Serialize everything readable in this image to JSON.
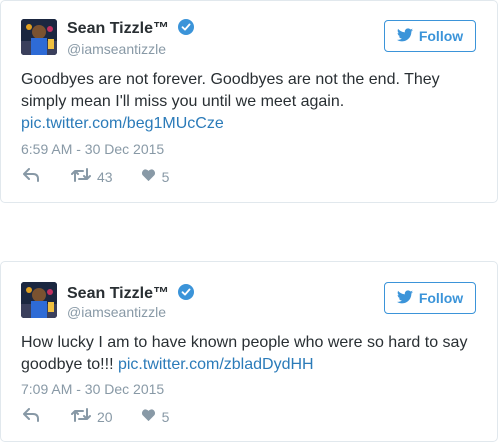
{
  "tweets": [
    {
      "author_name": "Sean Tizzle™",
      "handle": "@iamseantizzle",
      "follow_label": "Follow",
      "text": "Goodbyes are not forever. Goodbyes are not the end. They simply mean I'll miss you until we meet again.",
      "link": "pic.twitter.com/beg1MUcCze",
      "timestamp": "6:59 AM - 30 Dec 2015",
      "retweets": "43",
      "likes": "5"
    },
    {
      "author_name": "Sean Tizzle™",
      "handle": "@iamseantizzle",
      "follow_label": "Follow",
      "text": "How lucky I am to have known people who were so hard to say goodbye to!!!",
      "link": "pic.twitter.com/zbladDydHH",
      "timestamp": "7:09 AM - 30 Dec 2015",
      "retweets": "20",
      "likes": "5"
    }
  ],
  "icons": {
    "verified": "verified-badge-icon",
    "follow": "twitter-bird-icon",
    "reply": "reply-icon",
    "retweet": "retweet-icon",
    "like": "heart-icon"
  },
  "colors": {
    "accent": "#3b94d9",
    "link": "#2b7bb9",
    "muted": "#8899a6",
    "text": "#292f33",
    "border": "#e1e8ed"
  }
}
